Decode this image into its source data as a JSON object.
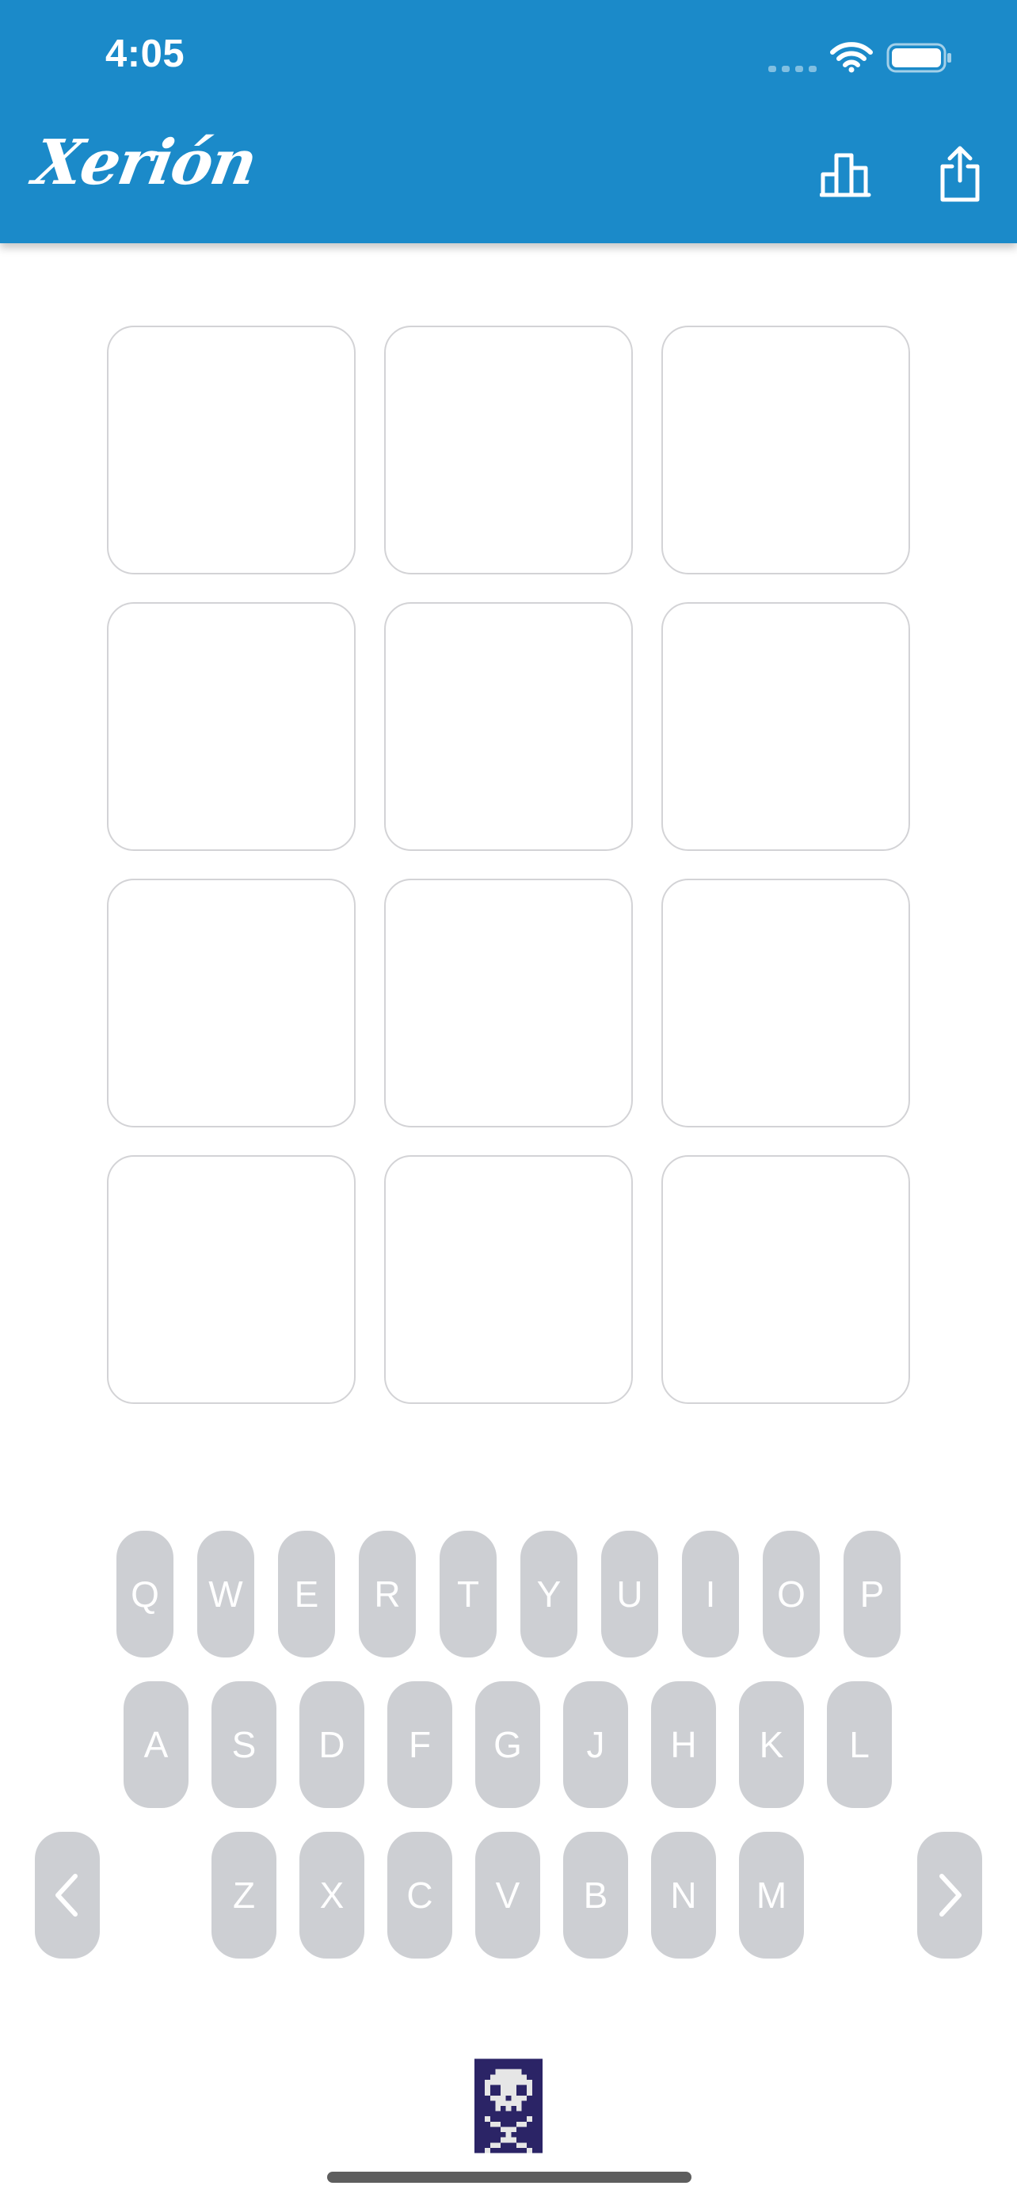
{
  "status_bar": {
    "time": "4:05",
    "wifi_icon": "wifi-icon",
    "battery_icon": "battery-icon"
  },
  "header": {
    "app_title": "Xerión",
    "background_color": "#1b8ac9",
    "stats_icon": "bar-chart-icon",
    "share_icon": "share-icon"
  },
  "grid": {
    "rows": 4,
    "columns": 3,
    "tiles": [
      "",
      "",
      "",
      "",
      "",
      "",
      "",
      "",
      "",
      "",
      "",
      ""
    ]
  },
  "keyboard": {
    "key_color": "#cdcfd3",
    "row1": [
      "Q",
      "W",
      "E",
      "R",
      "T",
      "Y",
      "U",
      "I",
      "O",
      "P"
    ],
    "row2": [
      "A",
      "S",
      "D",
      "F",
      "G",
      "J",
      "H",
      "K",
      "L"
    ],
    "row3": [
      "Z",
      "X",
      "C",
      "V",
      "B",
      "N",
      "M"
    ],
    "prev_icon": "chevron-left-icon",
    "next_icon": "chevron-right-icon"
  },
  "footer": {
    "logo_icon": "pixel-skull-icon"
  }
}
